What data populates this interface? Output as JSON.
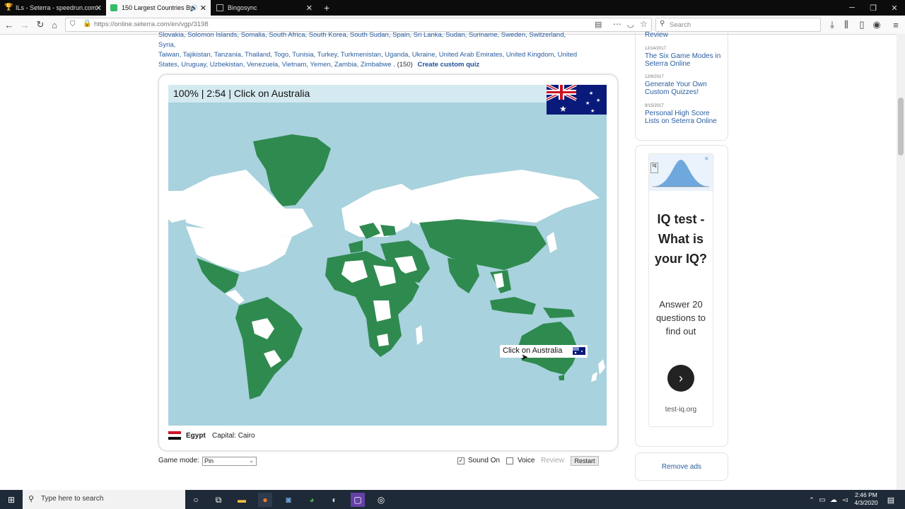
{
  "browser": {
    "tabs": [
      {
        "title": "ILs - Seterra - speedrun.com",
        "active": false
      },
      {
        "title": "150 Largest Countries By Ar",
        "active": true
      },
      {
        "title": "Bingosync",
        "active": false
      }
    ],
    "url": "https://online.seterra.com/en/vgp/3198",
    "search_placeholder": "Search"
  },
  "country_list": {
    "line1": "Slovakia, Solomon Islands, Somalia, South Africa, South Korea, South Sudan, Spain, Sri Lanka, Sudan, Suriname, Sweden, Switzerland, Syria,",
    "line2": "Taiwan, Tajikistan, Tanzania, Thailand, Togo, Tunisia, Turkey, Turkmenistan, Uganda, Ukraine, United Arab Emirates, United Kingdom, United",
    "line3": "States, Uruguay, Uzbekistan, Venezuela, Vietnam, Yemen, Zambia, Zimbabwe",
    "count": ". (150)",
    "create_custom": "Create custom quiz"
  },
  "game": {
    "status": "100% | 2:54 | Click on Australia",
    "tooltip": "Click on Australia",
    "last_country": "Egypt",
    "capital_label": "Capital:",
    "capital": "Cairo"
  },
  "controls": {
    "game_mode_label": "Game mode:",
    "game_mode_value": "Pin",
    "sound_label": "Sound On",
    "sound_checked": true,
    "voice_label": "Voice",
    "voice_checked": false,
    "review_label": "Review",
    "restart_label": "Restart"
  },
  "sidebar": {
    "partial_title": "Review",
    "news": [
      {
        "date": "12/14/2017",
        "title": "The Six Game Modes in Seterra Online"
      },
      {
        "date": "12/6/2017",
        "title": "Generate Your Own Custom Quizzes!"
      },
      {
        "date": "9/15/2017",
        "title": "Personal High Score Lists on Seterra Online"
      }
    ],
    "ad": {
      "headline": "IQ test - What is your IQ?",
      "body": "Answer 20 questions to find out",
      "domain": "test-iq.org"
    },
    "remove_ads": "Remove ads"
  },
  "taskbar": {
    "search_placeholder": "Type here to search",
    "time": "2:46 PM",
    "date": "4/3/2020"
  },
  "colors": {
    "ocean": "#a8d2dd",
    "correct_country": "#2f8a4f",
    "unanswered_country": "#ffffff",
    "link": "#2a5d9f"
  }
}
